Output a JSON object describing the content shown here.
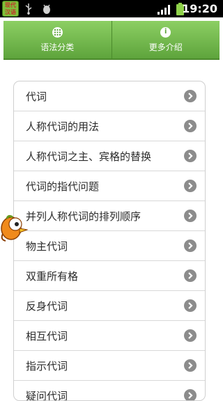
{
  "status_bar": {
    "app_badge_text": "现代汉语",
    "time": "19:20"
  },
  "tabs": [
    {
      "label": "语法分类",
      "icon": "grid-icon"
    },
    {
      "label": "更多介绍",
      "icon": "info-icon"
    }
  ],
  "list_items": [
    {
      "label": "代词"
    },
    {
      "label": "人称代词的用法"
    },
    {
      "label": "人称代词之主、宾格的替换"
    },
    {
      "label": "代词的指代问题"
    },
    {
      "label": "并列人称代词的排列顺序"
    },
    {
      "label": "物主代词"
    },
    {
      "label": "双重所有格"
    },
    {
      "label": "反身代词"
    },
    {
      "label": "相互代词"
    },
    {
      "label": "指示代词"
    },
    {
      "label": "疑问代词"
    }
  ],
  "colors": {
    "tab_bar": "#6fb347",
    "chevron": "#8c8c8c"
  }
}
